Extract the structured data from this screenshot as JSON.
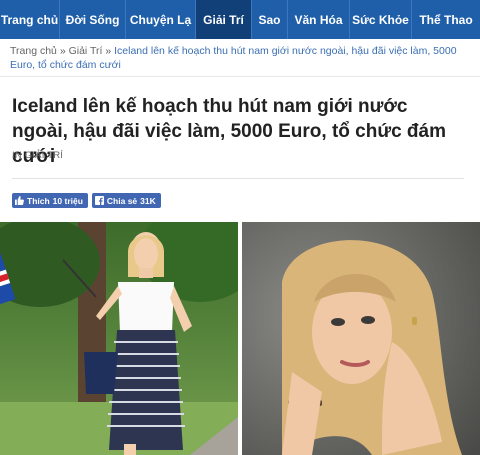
{
  "nav": {
    "items": [
      {
        "label": "Trang chủ"
      },
      {
        "label": "Đời Sống"
      },
      {
        "label": "Chuyện Lạ"
      },
      {
        "label": "Giải Trí"
      },
      {
        "label": "Sao"
      },
      {
        "label": "Văn Hóa"
      },
      {
        "label": "Sức Khỏe"
      },
      {
        "label": "Thể Thao"
      }
    ],
    "active_index": 3,
    "bg_color": "#1f5fa9",
    "active_color": "#113f78"
  },
  "breadcrumb": {
    "home": "Trang chủ",
    "separator": "»",
    "category": "Giải Trí",
    "current": "Iceland lên kế hoạch thu hút nam giới nước ngoài, hậu đãi việc làm, 5000 Euro, tổ chức đám cưới"
  },
  "article": {
    "title": "Iceland lên kế hoạch thu hút nam giới nước ngoài, hậu đãi việc làm, 5000 Euro, tổ chức đám cưới",
    "category": "IN GIẢI TRÍ"
  },
  "social": {
    "like_label": "Thích",
    "like_count": "10 triệu",
    "share_label": "Chia sẻ",
    "share_count": "31K",
    "color": "#4267b2"
  },
  "photos": [
    {
      "icon": "photo-woman-with-iceland-flag"
    },
    {
      "icon": "photo-woman-portrait"
    }
  ]
}
